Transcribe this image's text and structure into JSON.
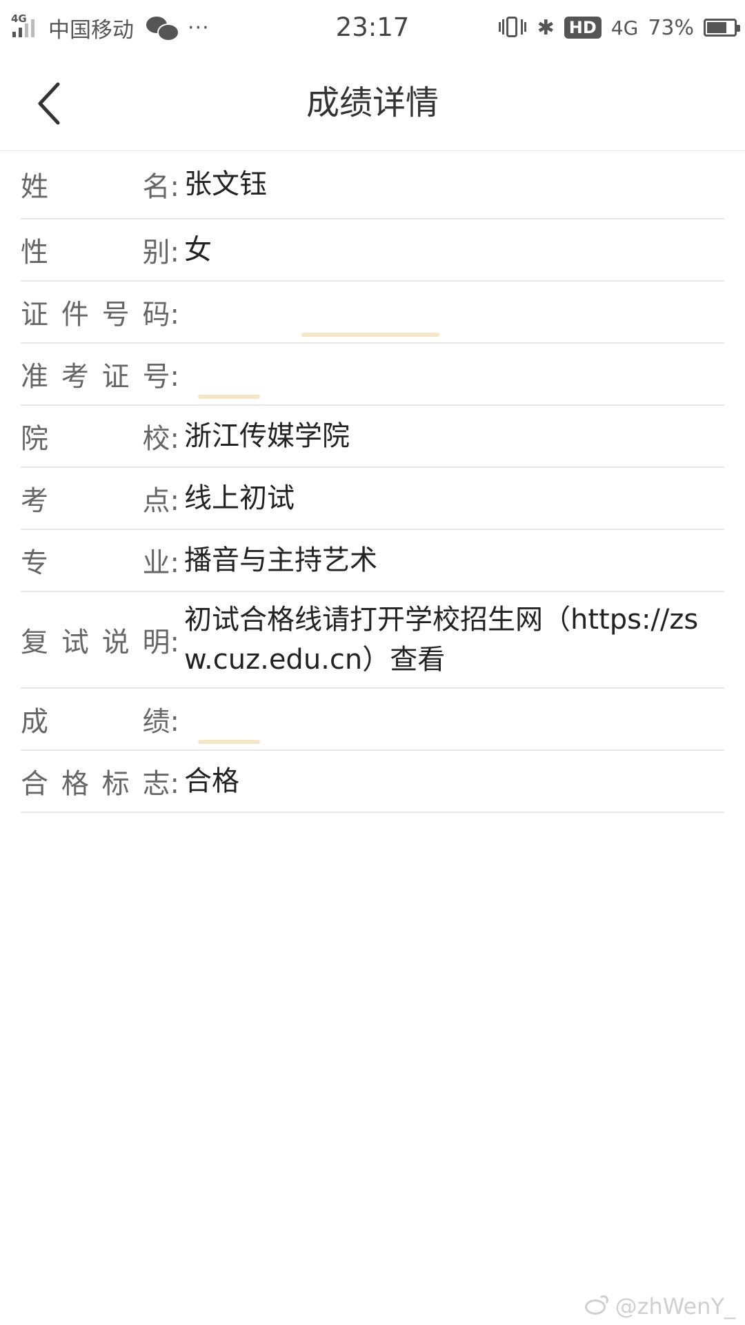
{
  "status_bar": {
    "signal_label": "4G",
    "carrier": "中国移动",
    "more": "···",
    "time": "23:17",
    "bluetooth_symbol": "✱",
    "hd_badge": "HD",
    "network": "4G",
    "battery_percent": "73%",
    "battery_level": 0.73,
    "icons": [
      "signal-icon",
      "wechat-icon",
      "vibrate-icon",
      "bluetooth-icon",
      "battery-icon"
    ]
  },
  "header": {
    "title": "成绩详情",
    "back_icon": "chevron-left-icon"
  },
  "rows": [
    {
      "label": [
        "姓",
        "名:"
      ],
      "value": "张文钰"
    },
    {
      "label": [
        "性",
        "别:"
      ],
      "value": "女"
    },
    {
      "label": [
        "证",
        "件",
        "号",
        "码:"
      ],
      "value": "",
      "redacted": true
    },
    {
      "label": [
        "准",
        "考",
        "证",
        "号:"
      ],
      "value": "",
      "redacted": true
    },
    {
      "label": [
        "院",
        "校:"
      ],
      "value": "浙江传媒学院"
    },
    {
      "label": [
        "考",
        "点:"
      ],
      "value": "线上初试"
    },
    {
      "label": [
        "专",
        "业:"
      ],
      "value": "播音与主持艺术"
    },
    {
      "label": [
        "复",
        "试",
        "说",
        "明:"
      ],
      "value": "初试合格线请打开学校招生网（https://zsw.cuz.edu.cn）查看"
    },
    {
      "label": [
        "成",
        "绩:"
      ],
      "value": "",
      "redacted": true
    },
    {
      "label": [
        "合",
        "格",
        "标",
        "志:"
      ],
      "value": "合格"
    }
  ],
  "watermark": {
    "text": "@zhWenY_"
  },
  "colors": {
    "background": "#ffffff",
    "label": "#666666",
    "value": "#222222",
    "divider": "#e5e5e5",
    "status_text": "#555555"
  }
}
